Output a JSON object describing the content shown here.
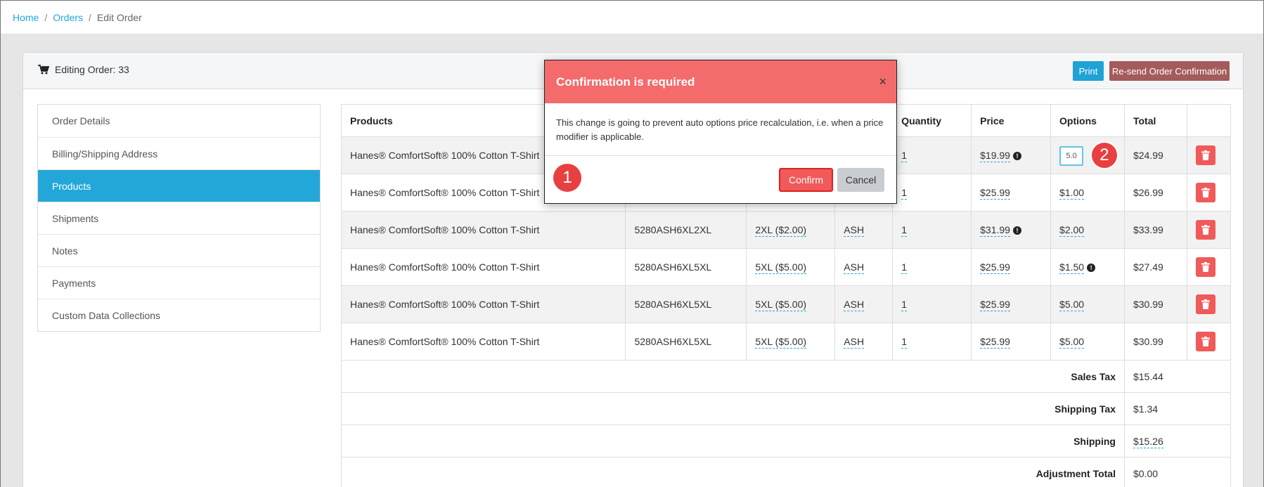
{
  "breadcrumb": {
    "home": "Home",
    "orders": "Orders",
    "current": "Edit Order",
    "separator": "/"
  },
  "header": {
    "order_title": "Editing Order: 33",
    "print_label": "Print",
    "resend_label": "Re-send Order Confirmation"
  },
  "sidebar": {
    "items": [
      {
        "label": "Order Details"
      },
      {
        "label": "Billing/Shipping Address"
      },
      {
        "label": "Products",
        "active": true
      },
      {
        "label": "Shipments"
      },
      {
        "label": "Notes"
      },
      {
        "label": "Payments"
      },
      {
        "label": "Custom Data Collections"
      }
    ]
  },
  "table": {
    "headers": {
      "products": "Products",
      "quantity": "Quantity",
      "price": "Price",
      "options": "Options",
      "total": "Total"
    },
    "rows": [
      {
        "product": "Hanes® ComfortSoft® 100% Cotton T-Shirt",
        "sku": "",
        "size": "",
        "color": "",
        "quantity": "1",
        "price": "$19.99",
        "price_info": true,
        "options": "5.0",
        "options_editing": true,
        "total": "$24.99"
      },
      {
        "product": "Hanes® ComfortSoft® 100% Cotton T-Shirt",
        "sku": "",
        "size": "",
        "color": "",
        "quantity": "1",
        "price": "$25.99",
        "price_info": false,
        "options": "$1.00",
        "options_info": false,
        "total": "$26.99"
      },
      {
        "product": "Hanes® ComfortSoft® 100% Cotton T-Shirt",
        "sku": "5280ASH6XL2XL",
        "size": "2XL ($2.00)",
        "color": "ASH",
        "quantity": "1",
        "price": "$31.99",
        "price_info": true,
        "options": "$2.00",
        "options_info": false,
        "total": "$33.99"
      },
      {
        "product": "Hanes® ComfortSoft® 100% Cotton T-Shirt",
        "sku": "5280ASH6XL5XL",
        "size": "5XL ($5.00)",
        "color": "ASH",
        "quantity": "1",
        "price": "$25.99",
        "price_info": false,
        "options": "$1.50",
        "options_info": true,
        "total": "$27.49"
      },
      {
        "product": "Hanes® ComfortSoft® 100% Cotton T-Shirt",
        "sku": "5280ASH6XL5XL",
        "size": "5XL ($5.00)",
        "color": "ASH",
        "quantity": "1",
        "price": "$25.99",
        "price_info": false,
        "options": "$5.00",
        "options_info": false,
        "total": "$30.99"
      },
      {
        "product": "Hanes® ComfortSoft® 100% Cotton T-Shirt",
        "sku": "5280ASH6XL5XL",
        "size": "5XL ($5.00)",
        "color": "ASH",
        "quantity": "1",
        "price": "$25.99",
        "price_info": false,
        "options": "$5.00",
        "options_info": false,
        "total": "$30.99"
      }
    ],
    "summary": [
      {
        "label": "Sales Tax",
        "value": "$15.44",
        "editable": false
      },
      {
        "label": "Shipping Tax",
        "value": "$1.34",
        "editable": false
      },
      {
        "label": "Shipping",
        "value": "$15.26",
        "editable": true
      },
      {
        "label": "Adjustment Total",
        "value": "$0.00",
        "editable": false
      }
    ]
  },
  "modal": {
    "title": "Confirmation is required",
    "close_symbol": "×",
    "body": "This change is going to prevent auto options price recalculation, i.e. when a price modifier is applicable.",
    "confirm_label": "Confirm",
    "cancel_label": "Cancel"
  },
  "annotations": {
    "badge_1": "1",
    "badge_2": "2"
  },
  "info_symbol": "!",
  "colors": {
    "accent": "#23a7d8",
    "modal_header": "#f46b6b",
    "danger": "#f05a5a",
    "resend": "#a45b5b"
  }
}
